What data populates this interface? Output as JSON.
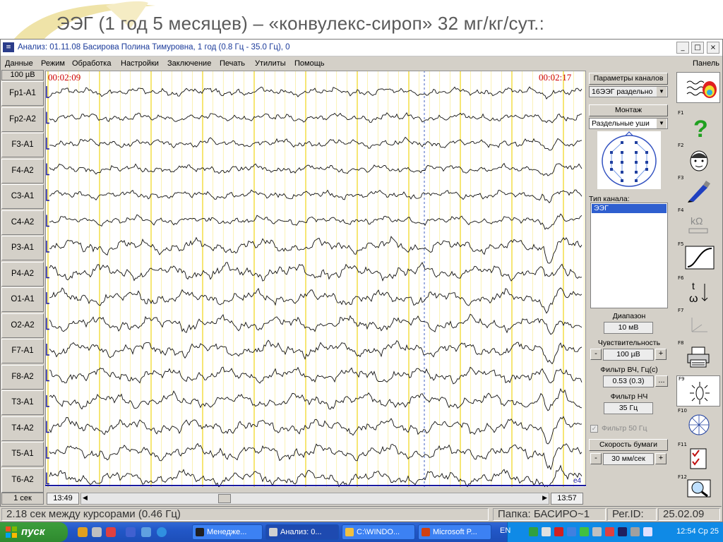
{
  "slide": {
    "title": "ЭЭГ (1 год 5 месяцев) – «конвулекс-сироп» 32 мг/кг/сут.:"
  },
  "window": {
    "title": "Анализ: 01.11.08 Басирова Полина Тимуровна, 1 год (0.8 Гц - 35.0 Гц), 0",
    "controls": [
      "_",
      "□",
      "×"
    ]
  },
  "menu": {
    "items": [
      "Данные",
      "Режим",
      "Обработка",
      "Настройки",
      "Заключение",
      "Печать",
      "Утилиты",
      "Помощь"
    ],
    "right": "Панель"
  },
  "plot": {
    "scale_label": "100 µВ",
    "time_start": "00:02:09",
    "time_end": "00:02:17",
    "channels": [
      "Fp1-A1",
      "Fp2-A2",
      "F3-A1",
      "F4-A2",
      "C3-A1",
      "C4-A2",
      "P3-A1",
      "P4-A2",
      "O1-A1",
      "O2-A2",
      "F7-A1",
      "F8-A2",
      "T3-A1",
      "T4-A2",
      "T5-A1",
      "T6-A2"
    ],
    "corner_mark": "e4",
    "sec_label": "1 сек",
    "scroll_left_time": "13:49",
    "scroll_right_time": "13:57"
  },
  "panel": {
    "channel_params_btn": "Параметры каналов",
    "channel_params_value": "16ЭЭГ раздельно",
    "montage_btn": "Монтаж",
    "montage_value": "Раздельные уши",
    "channel_type_label": "Тип канала:",
    "channel_type_selected": "ЭЭГ",
    "range_label": "Диапазон",
    "range_value": "10 мВ",
    "sensitivity_label": "Чувствительность",
    "sensitivity_value": "100 µВ",
    "hf_filter_label": "Фильтр ВЧ, Гц(с)",
    "hf_filter_value": "0.53 (0.3)",
    "lf_filter_label": "Фильтр НЧ",
    "lf_filter_value": "35 Гц",
    "notch_label": "Фильтр 50 Гц",
    "paper_speed_btn": "Скорость бумаги",
    "paper_speed_value": "30 мм/сек",
    "minus": "-",
    "plus": "+",
    "ellipsis": "..."
  },
  "toolbar": {
    "fkeys": [
      "F1",
      "F2",
      "F3",
      "F4",
      "F5",
      "F6",
      "F7",
      "F8",
      "F9",
      "F10",
      "F11",
      "F12"
    ],
    "kohm": "kΩ",
    "t_label": "t",
    "omega_label": "ω"
  },
  "status": {
    "cursor_info": "2.18 сек между курсорами (0.46 Гц)",
    "folder": "Папка: БАСИРО~1",
    "reg_id": "Рег.ID:",
    "date": "25.02.09"
  },
  "taskbar": {
    "start": "пуск",
    "tasks": [
      "Менедже...",
      "Анализ: 0...",
      "C:\\WINDO...",
      "Microsoft P..."
    ],
    "lang": "EN",
    "clock": "12:54 Ср 25"
  },
  "colors": {
    "trace": "#111111",
    "grid_yellow": "#f0d000",
    "grid_cursor": "#4060c0",
    "time_red": "#cc0000",
    "title_blue": "#1a3a9a",
    "plot_border": "#1a1aa0"
  }
}
